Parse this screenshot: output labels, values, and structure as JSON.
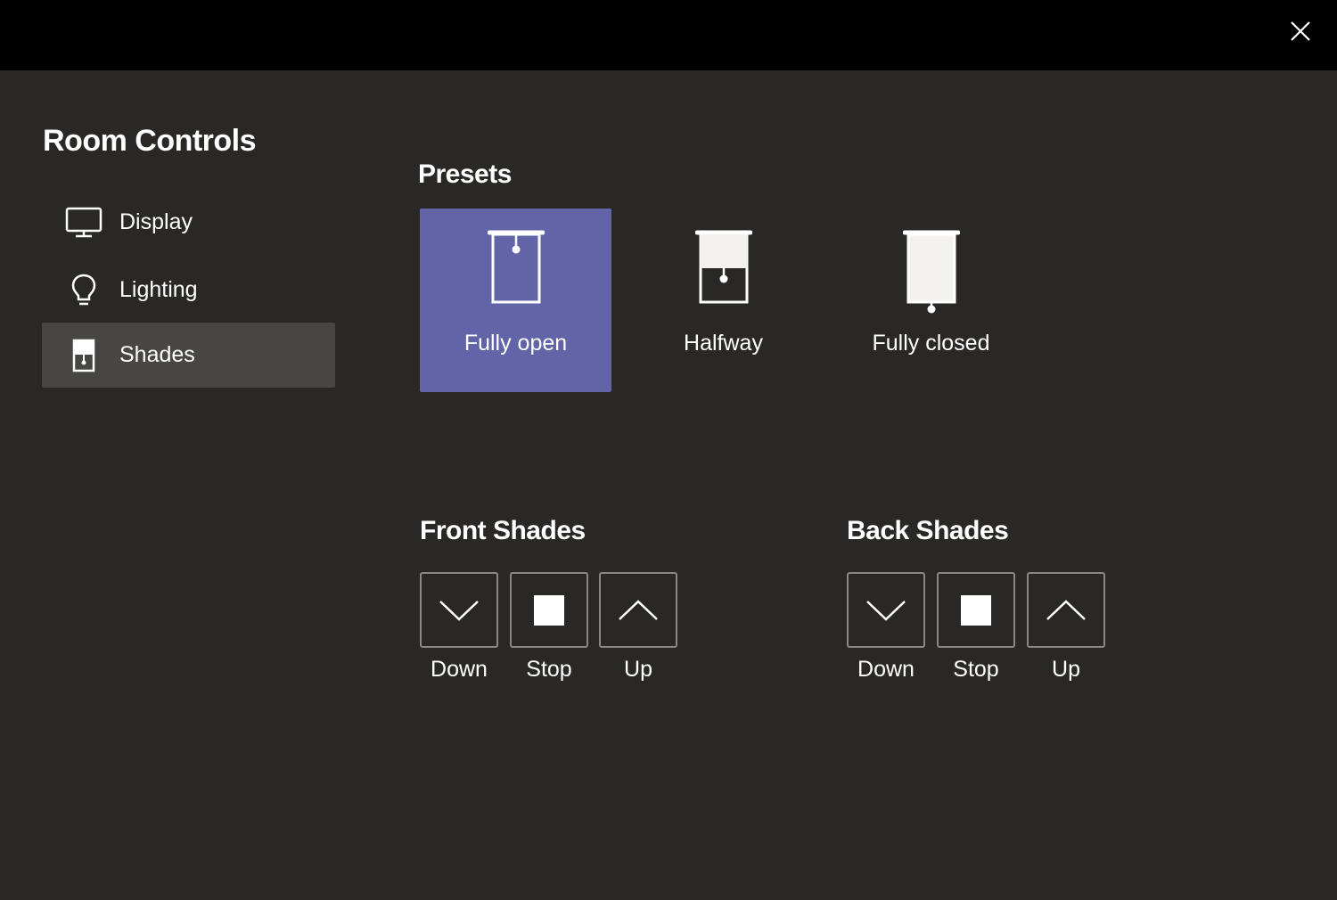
{
  "sidebar": {
    "title": "Room Controls",
    "items": [
      {
        "label": "Display",
        "icon": "monitor-icon"
      },
      {
        "label": "Lighting",
        "icon": "lightbulb-icon"
      },
      {
        "label": "Shades",
        "icon": "shade-icon",
        "selected": true
      }
    ]
  },
  "presets": {
    "title": "Presets",
    "items": [
      {
        "label": "Fully open",
        "icon": "shade-open-icon",
        "active": true
      },
      {
        "label": "Halfway",
        "icon": "shade-halfway-icon"
      },
      {
        "label": "Fully closed",
        "icon": "shade-closed-icon"
      }
    ]
  },
  "front_shades": {
    "title": "Front Shades",
    "down": "Down",
    "stop": "Stop",
    "up": "Up"
  },
  "back_shades": {
    "title": "Back Shades",
    "down": "Down",
    "stop": "Stop",
    "up": "Up"
  },
  "colors": {
    "accent": "#6264a7",
    "background": "#292827",
    "topbar": "#000000",
    "selected_nav": "#474644"
  }
}
